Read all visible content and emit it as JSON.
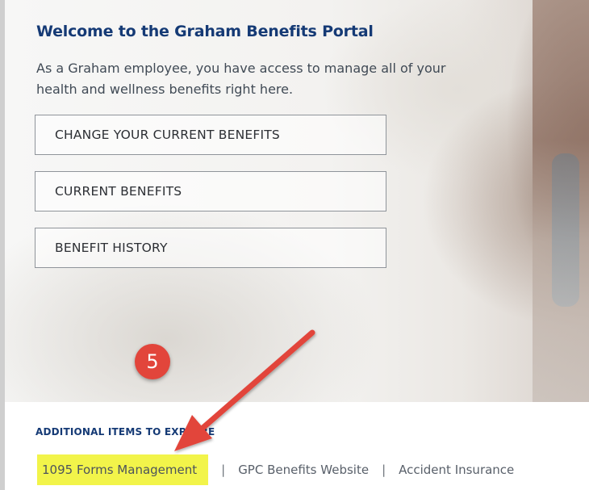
{
  "hero": {
    "title": "Welcome to the Graham Benefits Portal",
    "description": "As a Graham employee, you have access to manage all of your health and wellness benefits right here.",
    "buttons": [
      {
        "label": "CHANGE YOUR CURRENT BENEFITS"
      },
      {
        "label": "CURRENT BENEFITS"
      },
      {
        "label": "BENEFIT HISTORY"
      }
    ]
  },
  "annotation": {
    "step_number": "5",
    "marker_color": "#e2453b",
    "highlight_color": "#f2f44a",
    "arrow_icon": "red-arrow-icon"
  },
  "explore": {
    "heading": "ADDITIONAL ITEMS TO EXPLORE",
    "links": [
      {
        "label": "1095 Forms Management"
      },
      {
        "label": "GPC Benefits Website"
      },
      {
        "label": "Accident Insurance"
      }
    ],
    "separator": "|"
  },
  "colors": {
    "brand_navy": "#153a75",
    "text_gray": "#404a55"
  }
}
